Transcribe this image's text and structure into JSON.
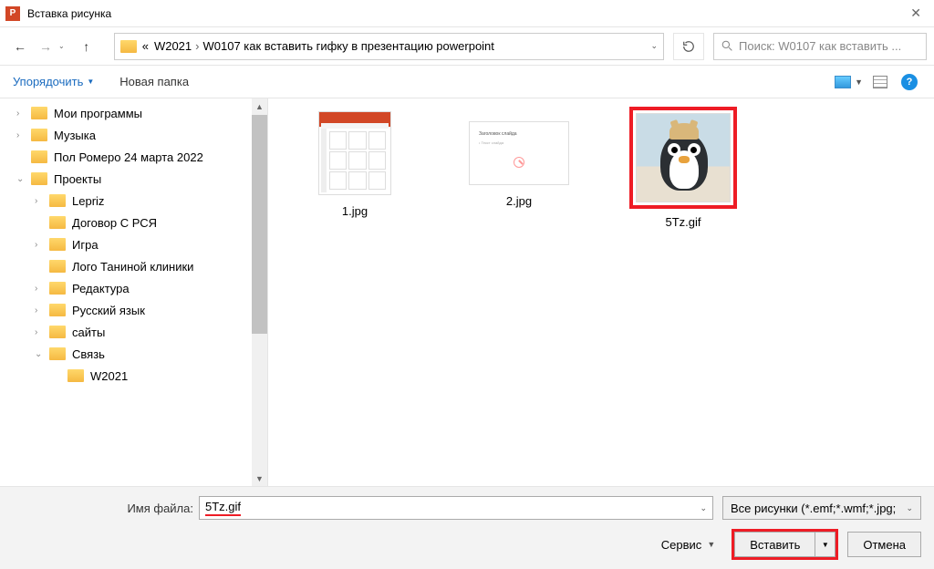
{
  "window": {
    "title": "Вставка рисунка"
  },
  "nav": {
    "breadcrumb_prefix": "«",
    "crumb1": "W2021",
    "crumb2": "W0107 как вставить гифку в презентацию powerpoint",
    "search_placeholder": "Поиск: W0107 как вставить ..."
  },
  "toolbar": {
    "organize": "Упорядочить",
    "new_folder": "Новая папка",
    "help": "?"
  },
  "sidebar": {
    "items": [
      {
        "label": "Мои программы",
        "indent": 1
      },
      {
        "label": "Музыка",
        "indent": 1
      },
      {
        "label": "Пол Ромеро 24 марта 2022",
        "indent": 1
      },
      {
        "label": "Проекты",
        "indent": 1,
        "expanded": true
      },
      {
        "label": "Lepriz",
        "indent": 2
      },
      {
        "label": "Договор С РСЯ",
        "indent": 2
      },
      {
        "label": "Игра",
        "indent": 2
      },
      {
        "label": "Лого Таниной клиники",
        "indent": 2
      },
      {
        "label": "Редактура",
        "indent": 2
      },
      {
        "label": "Русский язык",
        "indent": 2
      },
      {
        "label": "сайты",
        "indent": 2
      },
      {
        "label": "Связь",
        "indent": 2,
        "expanded": true
      },
      {
        "label": "W2021",
        "indent": 3
      }
    ]
  },
  "files": [
    {
      "name": "1.jpg",
      "kind": "ppt"
    },
    {
      "name": "2.jpg",
      "kind": "slide"
    },
    {
      "name": "5Tz.gif",
      "kind": "penguin",
      "selected": true
    }
  ],
  "bottom": {
    "filename_label": "Имя файла:",
    "filename_value": "5Tz.gif",
    "filter": "Все рисунки (*.emf;*.wmf;*.jpg;",
    "service": "Сервис",
    "insert": "Вставить",
    "cancel": "Отмена"
  }
}
